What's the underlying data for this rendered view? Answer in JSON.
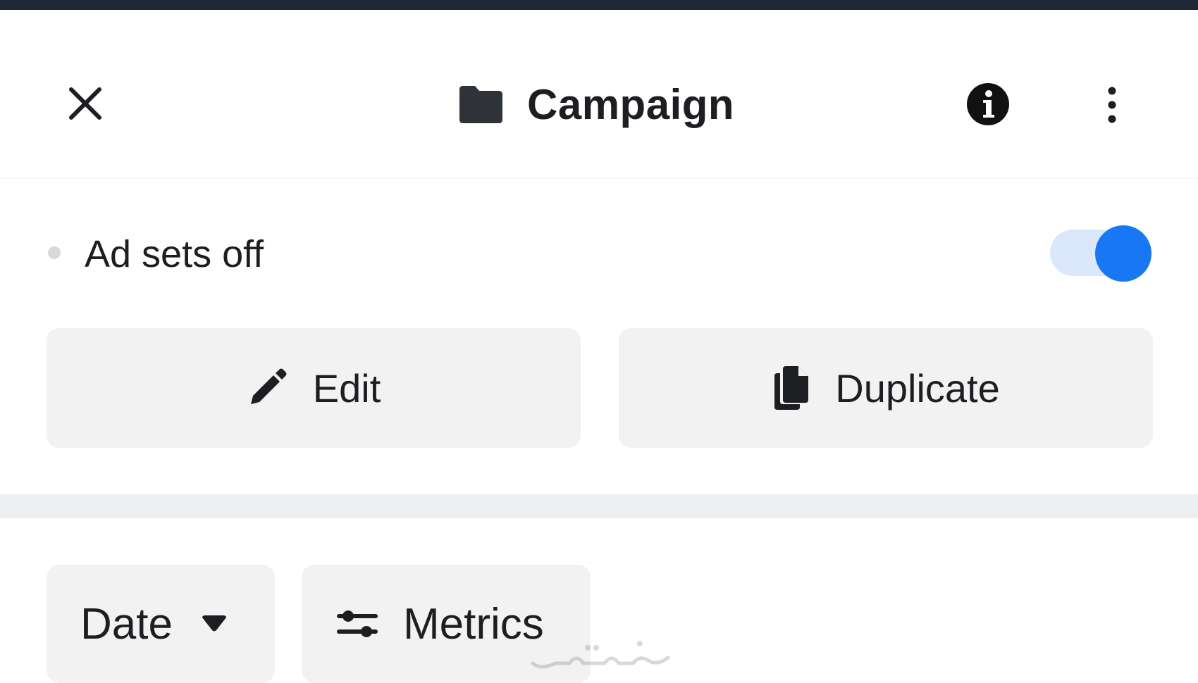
{
  "header": {
    "title": "Campaign",
    "close_icon": "close-icon",
    "folder_icon": "folder-icon",
    "info_icon": "info-icon",
    "more_icon": "more-vertical-icon"
  },
  "status": {
    "label": "Ad sets off",
    "toggle_on": true
  },
  "actions": {
    "edit_label": "Edit",
    "edit_icon": "pencil-icon",
    "duplicate_label": "Duplicate",
    "duplicate_icon": "copy-icon"
  },
  "filters": {
    "date_label": "Date",
    "date_icon": "caret-down-icon",
    "metrics_label": "Metrics",
    "metrics_icon": "sliders-icon"
  },
  "colors": {
    "accent": "#1877f2",
    "toggle_track": "#dbe7fb",
    "button_bg": "#f2f2f2",
    "text": "#1c1e21",
    "top_bar": "#1f2733"
  }
}
